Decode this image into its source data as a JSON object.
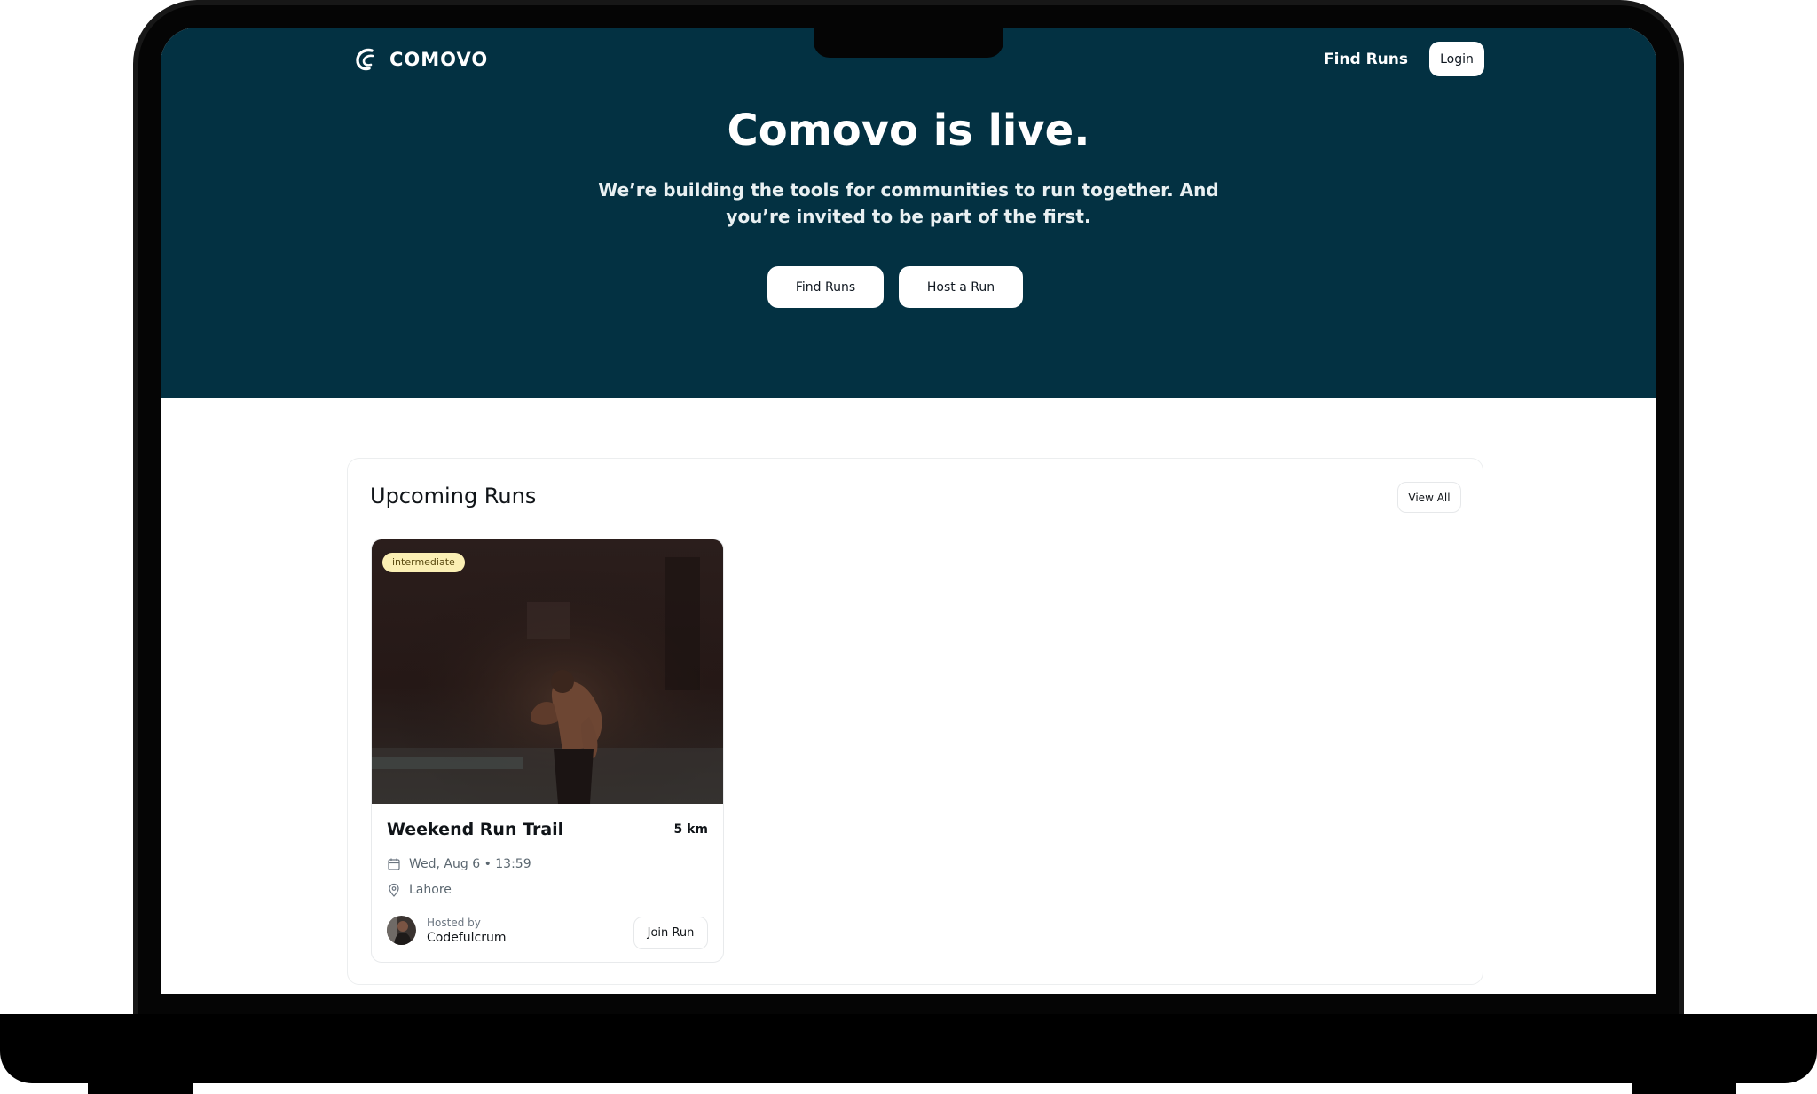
{
  "nav": {
    "logo_text": "COMOVO",
    "find_runs_label": "Find Runs",
    "login_label": "Login"
  },
  "hero": {
    "title": "Comovo is live.",
    "subtitle": "We’re building the tools for communities to run together. And you’re invited to be part of the first.",
    "find_runs_button": "Find Runs",
    "host_run_button": "Host a Run",
    "background_color": "#033142"
  },
  "upcoming": {
    "title": "Upcoming Runs",
    "view_all_label": "View All",
    "runs": [
      {
        "level": "intermediate",
        "title": "Weekend Run Trail",
        "distance": "5 km",
        "date_time": "Wed, Aug 6 • 13:59",
        "location": "Lahore",
        "hosted_by_label": "Hosted by",
        "host_name": "Codefulcrum",
        "join_label": "Join Run"
      }
    ]
  },
  "icons": {
    "logo": "comovo-logo-icon",
    "calendar": "calendar-icon",
    "location": "map-pin-icon"
  },
  "colors": {
    "badge_bg": "#fbefb4",
    "accent_dark": "#033142"
  }
}
